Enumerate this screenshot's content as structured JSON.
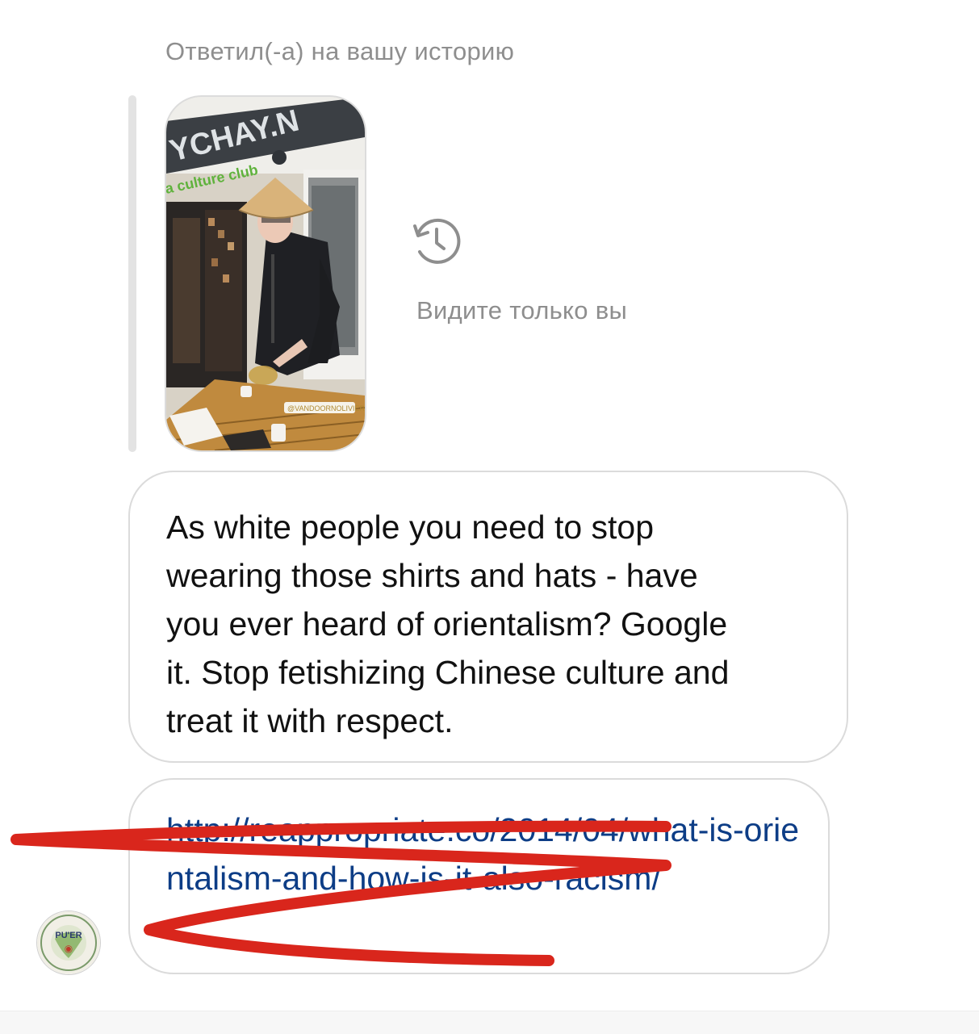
{
  "reply_context": {
    "label": "Ответил(-а) на вашу историю",
    "story_thumbnail_icon": "story-photo-thumbnail",
    "story_text": {
      "sign": "YCHAY.N",
      "sub_sign": "a culture club",
      "tag": "@VANDOORNOLIVIER"
    }
  },
  "visibility": {
    "icon": "history-clock-icon",
    "text": "Видите только вы"
  },
  "messages": [
    {
      "type": "text",
      "text": "As white people you need to stop\nwearing those shirts and hats - have\nyou ever heard of orientalism? Google\nit. Stop fetishizing Chinese culture and\ntreat it with respect."
    },
    {
      "type": "link",
      "text": "http://reappropriate.co/2014/04/what-is-orientalism-and-how-is-it-also-racism/"
    }
  ],
  "sender": {
    "avatar_icon": "puer-logo-avatar",
    "avatar_text": "PU'ER"
  },
  "colors": {
    "secondary_text": "#8e8e8e",
    "link": "#0d3d86",
    "bubble_border": "#dbdbdb",
    "scribble": "#d9261c"
  }
}
